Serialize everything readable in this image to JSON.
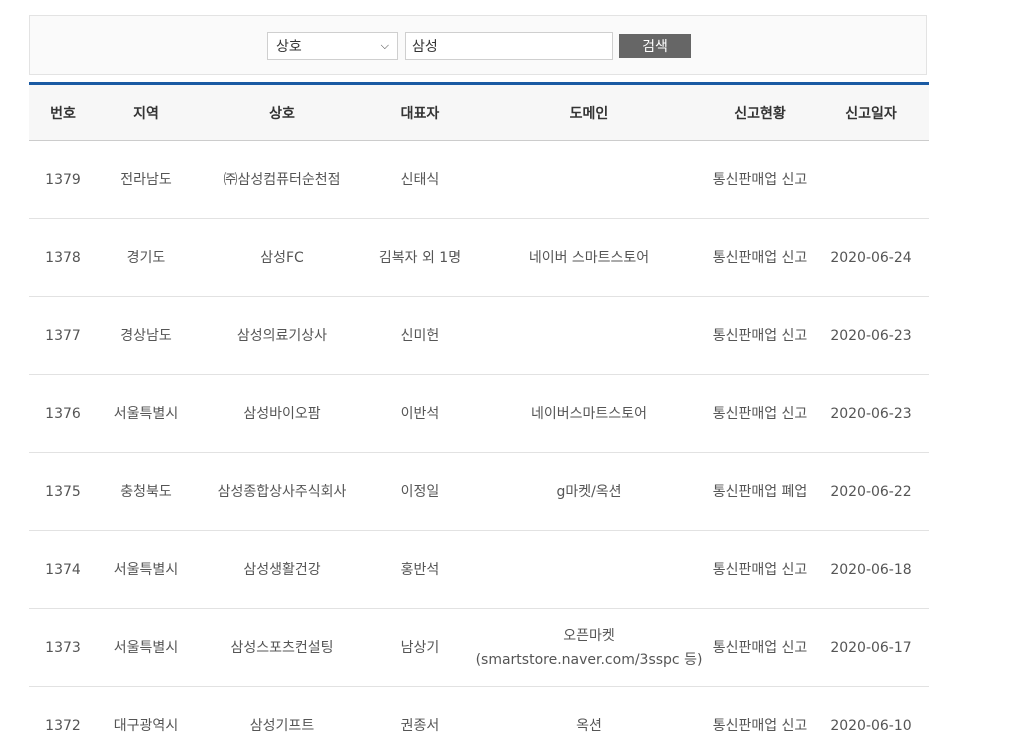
{
  "search": {
    "field_selected": "상호",
    "query": "삼성",
    "button_label": "검색"
  },
  "table": {
    "headers": [
      "번호",
      "지역",
      "상호",
      "대표자",
      "도메인",
      "신고현황",
      "신고일자"
    ],
    "rows": [
      {
        "no": "1379",
        "region": "전라남도",
        "name": "㈜삼성컴퓨터순천점",
        "rep": "신태식",
        "domain": "",
        "status": "통신판매업 신고",
        "date": ""
      },
      {
        "no": "1378",
        "region": "경기도",
        "name": "삼성FC",
        "rep": "김복자 외 1명",
        "domain": "네이버 스마트스토어",
        "status": "통신판매업 신고",
        "date": "2020-06-24"
      },
      {
        "no": "1377",
        "region": "경상남도",
        "name": "삼성의료기상사",
        "rep": "신미헌",
        "domain": "",
        "status": "통신판매업 신고",
        "date": "2020-06-23"
      },
      {
        "no": "1376",
        "region": "서울특별시",
        "name": "삼성바이오팜",
        "rep": "이반석",
        "domain": "네이버스마트스토어",
        "status": "통신판매업 신고",
        "date": "2020-06-23"
      },
      {
        "no": "1375",
        "region": "충청북도",
        "name": "삼성종합상사주식회사",
        "rep": "이정일",
        "domain": "g마켓/옥션",
        "status": "통신판매업 폐업",
        "date": "2020-06-22"
      },
      {
        "no": "1374",
        "region": "서울특별시",
        "name": "삼성생활건강",
        "rep": "홍반석",
        "domain": "",
        "status": "통신판매업 신고",
        "date": "2020-06-18"
      },
      {
        "no": "1373",
        "region": "서울특별시",
        "name": "삼성스포츠컨설팅",
        "rep": "남상기",
        "domain": "오픈마켓 (smartstore.naver.com/3sspc 등)",
        "status": "통신판매업 신고",
        "date": "2020-06-17"
      },
      {
        "no": "1372",
        "region": "대구광역시",
        "name": "삼성기프트",
        "rep": "권종서",
        "domain": "옥션",
        "status": "통신판매업 신고",
        "date": "2020-06-10"
      }
    ]
  }
}
